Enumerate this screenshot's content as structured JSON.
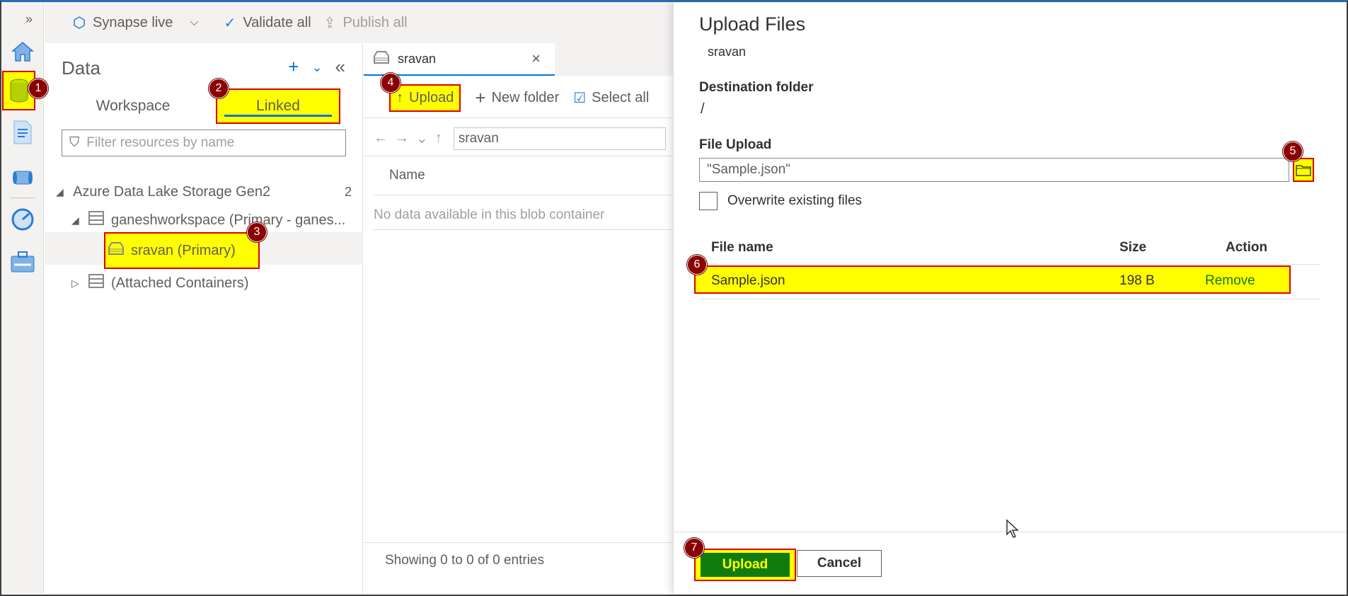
{
  "topbar": {
    "mode_label": "Synapse live",
    "validate_label": "Validate all",
    "publish_label": "Publish all"
  },
  "data_panel": {
    "title": "Data",
    "tabs": [
      "Workspace",
      "Linked"
    ],
    "filter_placeholder": "Filter resources by name",
    "tree": {
      "group_label": "Azure Data Lake Storage Gen2",
      "group_count": "2",
      "workspace_label": "ganeshworkspace (Primary - ganes...",
      "container_label": "sravan (Primary)",
      "attached_label": "(Attached Containers)"
    }
  },
  "center": {
    "tab_title": "sravan",
    "toolbar": {
      "upload_label": "Upload",
      "new_folder_label": "New folder",
      "select_all_label": "Select all"
    },
    "path": "sravan",
    "column_name": "Name",
    "empty_message": "No data available in this blob container",
    "entries_text": "Showing 0 to 0 of 0 entries"
  },
  "dialog": {
    "title": "Upload Files",
    "container": "sravan",
    "destination_label": "Destination folder",
    "destination_value": "/",
    "file_upload_label": "File Upload",
    "file_input_value": "\"Sample.json\"",
    "overwrite_label": "Overwrite existing files",
    "columns": {
      "file_name": "File name",
      "size": "Size",
      "action": "Action"
    },
    "files": [
      {
        "name": "Sample.json",
        "size": "198 B",
        "action": "Remove"
      }
    ],
    "upload_button": "Upload",
    "cancel_button": "Cancel"
  },
  "callouts": [
    "1",
    "2",
    "3",
    "4",
    "5",
    "6",
    "7"
  ],
  "colors": {
    "highlight": "#ffff00",
    "highlight_border": "#e00000",
    "callout": "#8b0000",
    "primary_button": "#107c10",
    "accent": "#0078d4"
  }
}
